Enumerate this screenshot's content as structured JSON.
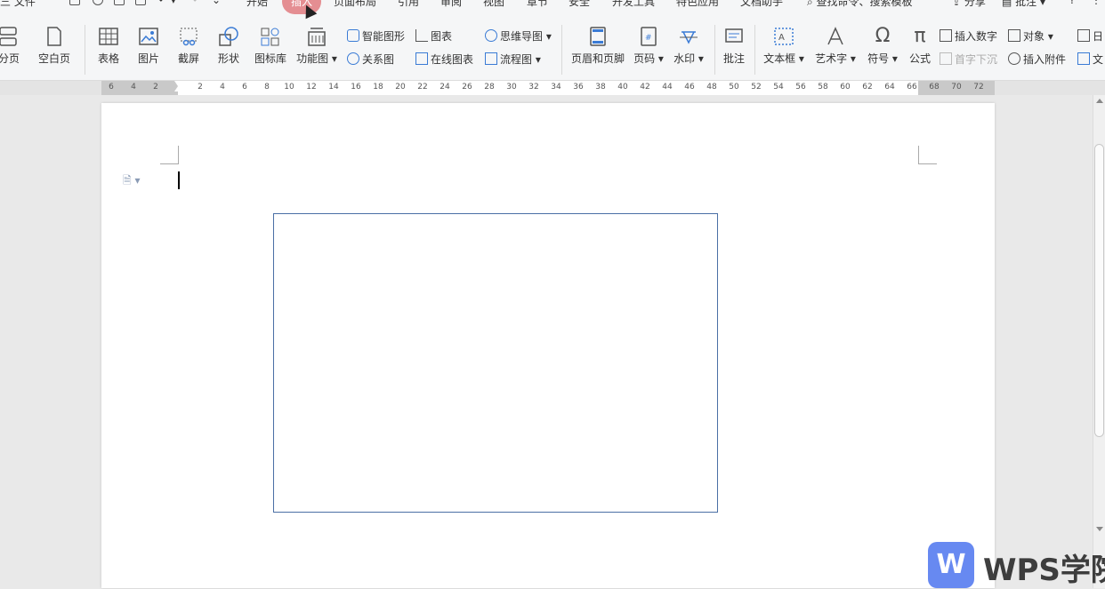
{
  "menubar": {
    "file": "三 文件",
    "tabs": [
      "开始",
      "插入",
      "页面布局",
      "引用",
      "审阅",
      "视图",
      "章节",
      "安全",
      "开发工具",
      "特色应用",
      "文档助手"
    ],
    "search": "查找命令、搜索模板",
    "share": "分享",
    "comment": "批注",
    "help": "?",
    "more": "⋮",
    "active_color": "#e07b80"
  },
  "ribbon": {
    "page_break": "分页",
    "blank_page": "空白页",
    "table": "表格",
    "picture": "图片",
    "screenshot": "截屏",
    "shape": "形状",
    "icon_lib": "图标库",
    "function_chart": "功能图",
    "smart_art": "智能图形",
    "chart": "图表",
    "relation": "关系图",
    "online_chart": "在线图表",
    "mindmap": "思维导图",
    "flowchart": "流程图",
    "header_footer": "页眉和页脚",
    "page_number": "页码",
    "watermark": "水印",
    "annotation": "批注",
    "textbox": "文本框",
    "wordart": "艺术字",
    "symbol": "符号",
    "formula": "公式",
    "insert_number": "插入数字",
    "object": "对象",
    "drop_cap": "首字下沉",
    "attachment": "插入附件",
    "date": "日",
    "doc": "文"
  },
  "ruler": {
    "ticks": [
      "6",
      "4",
      "2",
      "2",
      "4",
      "6",
      "8",
      "10",
      "12",
      "14",
      "16",
      "18",
      "20",
      "22",
      "24",
      "26",
      "28",
      "30",
      "32",
      "34",
      "36",
      "38",
      "40",
      "42",
      "44",
      "46",
      "48",
      "50",
      "52",
      "54",
      "56",
      "58",
      "60",
      "62",
      "64",
      "66",
      "68",
      "70",
      "72"
    ]
  },
  "brand": {
    "logo_letter": "W",
    "name": "WPS学院",
    "color": "#5b7ff0"
  }
}
